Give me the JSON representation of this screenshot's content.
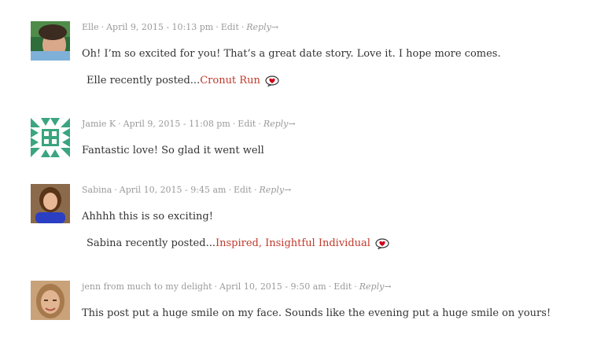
{
  "comments": [
    {
      "author": "Elle",
      "date": "April 9, 2015 - 10:13 pm",
      "edit": "Edit",
      "reply": "Reply",
      "text": "Oh! I’m so excited for you! That’s a great date story. Love it. I hope more comes.",
      "luv_prefix": "Elle recently posted...",
      "luv_link": "Cronut Run"
    },
    {
      "author": "Jamie K",
      "date": "April 9, 2015 - 11:08 pm",
      "edit": "Edit",
      "reply": "Reply",
      "text": "Fantastic love! So glad it went well"
    },
    {
      "author": "Sabina",
      "date": "April 10, 2015 - 9:45 am",
      "edit": "Edit",
      "reply": "Reply",
      "text": "Ahhhh this is so exciting!",
      "luv_prefix": "Sabina recently posted...",
      "luv_link": "Inspired, Insightful Individual"
    },
    {
      "author": "jenn from much to my delight",
      "date": "April 10, 2015 - 9:50 am",
      "edit": "Edit",
      "reply": "Reply",
      "text": "This post put a huge smile on my face. Sounds like the evening put a huge smile on yours!"
    }
  ],
  "separator": "·",
  "reply_arrow": "→",
  "colors": {
    "link": "#c0392b",
    "meta": "#9a9a9a",
    "identicon": "#3aa57f"
  },
  "icons": {
    "luv": "commentluv-heart-icon"
  }
}
